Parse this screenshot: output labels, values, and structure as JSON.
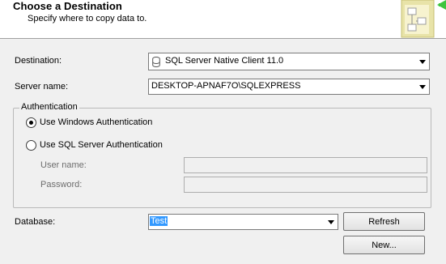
{
  "header": {
    "title": "Choose a Destination",
    "subtitle": "Specify where to copy data to."
  },
  "destination": {
    "label": "Destination:",
    "value": "SQL Server Native Client 11.0",
    "icon": "database-icon"
  },
  "server": {
    "label": "Server name:",
    "value": "DESKTOP-APNAF7O\\SQLEXPRESS"
  },
  "authentication": {
    "legend": "Authentication",
    "windows_label": "Use Windows Authentication",
    "sql_label": "Use SQL Server Authentication",
    "selected": "windows",
    "username_label": "User name:",
    "username_value": "",
    "password_label": "Password:",
    "password_value": ""
  },
  "database": {
    "label": "Database:",
    "value": "Test",
    "refresh_label": "Refresh",
    "new_label": "New..."
  },
  "colors": {
    "selection": "#3399ff",
    "header_bg": "#ffffff",
    "dialog_bg": "#f0f0f0",
    "arrow_green": "#3ec43e"
  }
}
